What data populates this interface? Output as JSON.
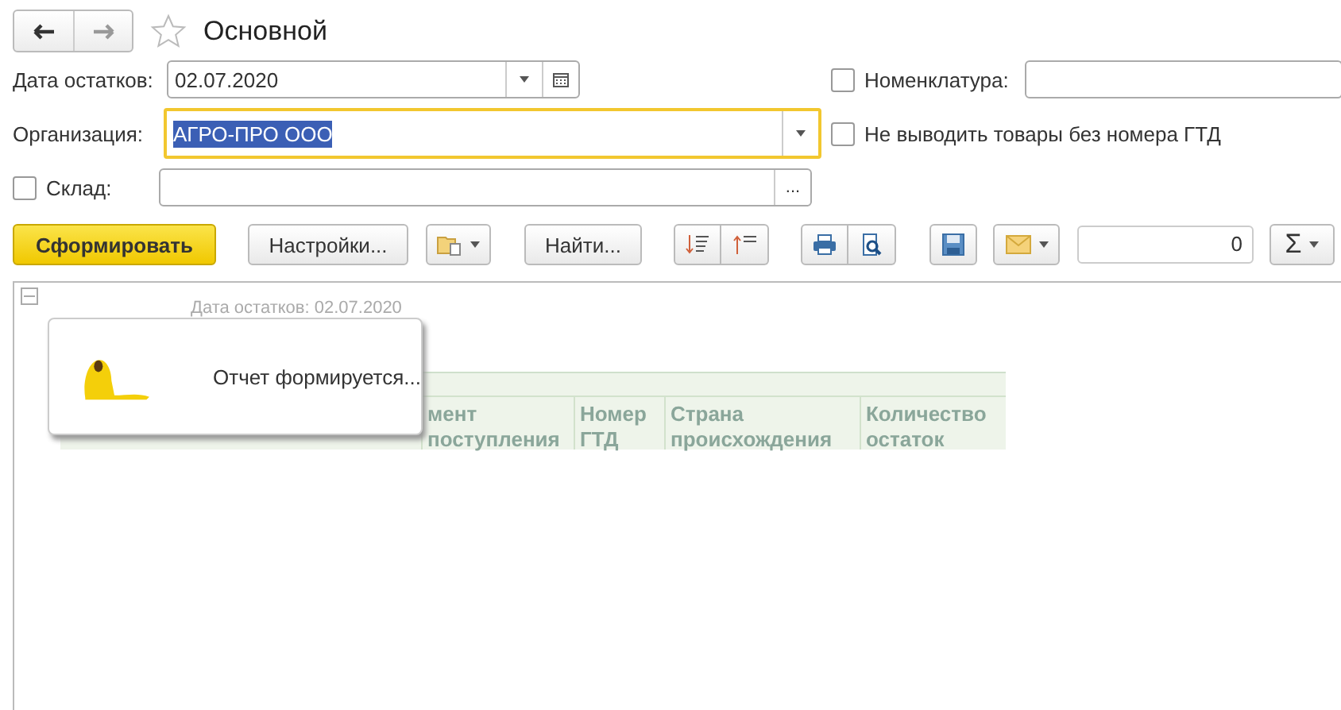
{
  "window": {
    "title": "Основной"
  },
  "fields": {
    "date": {
      "label": "Дата остатков:",
      "value": "02.07.2020"
    },
    "nomenclature": {
      "label": "Номенклатура:",
      "checked": false
    },
    "organization": {
      "label": "Организация:",
      "value": "АГРО-ПРО ООО",
      "focused": true
    },
    "no_gtd": {
      "label": "Не выводить товары без номера ГТД",
      "checked": false
    },
    "warehouse": {
      "label": "Склад:",
      "checked": false,
      "button": "..."
    }
  },
  "toolbar": {
    "generate": "Сформировать",
    "settings": "Настройки...",
    "find": "Найти...",
    "total": "0",
    "sum": "Σ"
  },
  "report": {
    "parameter_line": "Дата остатков: 02.07.2020",
    "columns": [
      {
        "text": "мент поступления"
      },
      {
        "text": "Номер ГТД"
      },
      {
        "text": "Страна происхождения"
      },
      {
        "text": "Количество остаток"
      }
    ]
  },
  "popup": {
    "message": "Отчет формируется..."
  }
}
